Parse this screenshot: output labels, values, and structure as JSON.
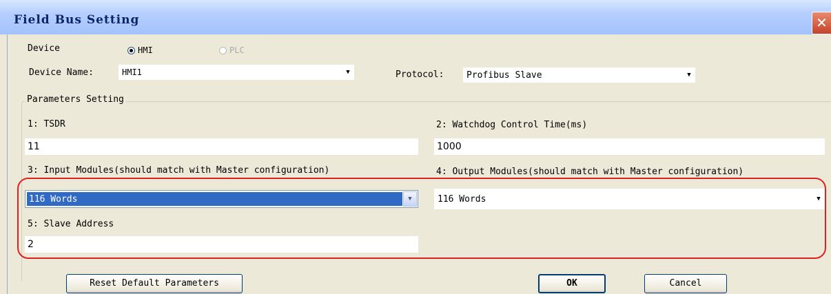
{
  "window": {
    "title": "Field Bus Setting",
    "close_symbol": "✕"
  },
  "device": {
    "label": "Device",
    "option_hmi": "HMI",
    "option_plc": "PLC",
    "selected": "HMI"
  },
  "device_name": {
    "label": "Device Name:",
    "value": "HMI1"
  },
  "protocol": {
    "label": "Protocol:",
    "value": "Profibus Slave"
  },
  "parameters": {
    "group_title": "Parameters Setting",
    "tsdr": {
      "label": "1: TSDR",
      "value": "11"
    },
    "watchdog": {
      "label": "2: Watchdog Control Time(ms)",
      "value": "1000"
    },
    "input_modules": {
      "label": "3: Input Modules(should match with Master configuration)",
      "value": "116 Words"
    },
    "output_modules": {
      "label": "4: Output Modules(should match with Master configuration)",
      "value": "116 Words"
    },
    "slave_address": {
      "label": "5: Slave Address",
      "value": "2"
    }
  },
  "buttons": {
    "reset": "Reset Default Parameters",
    "ok": "OK",
    "cancel": "Cancel"
  },
  "icons": {
    "dropdown": "chevron-down-icon",
    "close": "close-icon"
  },
  "colors": {
    "selection": "#316ac5",
    "highlight_oval": "#e02020",
    "title_text": "#0a246a"
  }
}
